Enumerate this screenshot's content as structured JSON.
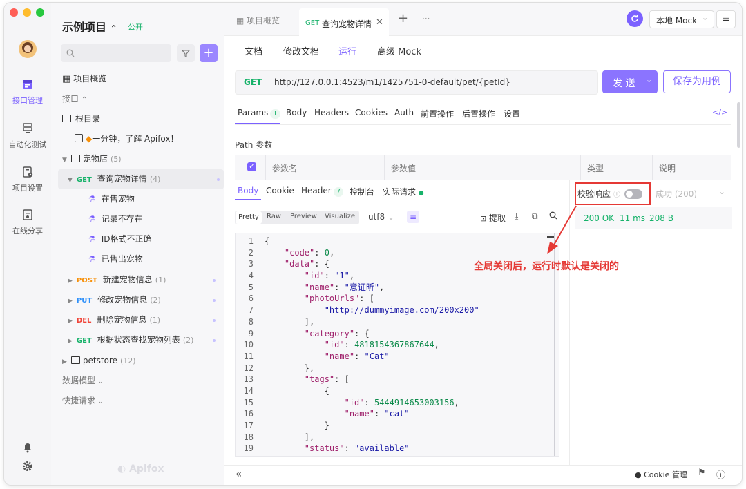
{
  "window": {
    "traffic_lights": [
      "#ff5f57",
      "#febc2e",
      "#28c840"
    ]
  },
  "rail": {
    "items": [
      {
        "label": "接口管理",
        "icon": "api-management-icon",
        "active": true
      },
      {
        "label": "自动化测试",
        "icon": "automation-test-icon",
        "active": false
      },
      {
        "label": "项目设置",
        "icon": "project-settings-icon",
        "active": false
      },
      {
        "label": "在线分享",
        "icon": "online-share-icon",
        "active": false
      }
    ],
    "bottom_icons": [
      "bell-icon",
      "gear-icon"
    ]
  },
  "sidebar": {
    "project_name": "示例项目",
    "project_visibility": "公开",
    "overview_label": "项目概览",
    "interfaces_label": "接口",
    "root_label": "根目录",
    "intro_doc": "一分钟，了解 Apifox！",
    "petstore_folder": {
      "label": "宠物店",
      "count": "(5)"
    },
    "active_endpoint": {
      "method": "GET",
      "label": "查询宠物详情",
      "count": "(4)"
    },
    "cases": [
      "在售宠物",
      "记录不存在",
      "ID格式不正确",
      "已售出宠物"
    ],
    "endpoints": [
      {
        "method": "POST",
        "label": "新建宠物信息",
        "count": "(1)"
      },
      {
        "method": "PUT",
        "label": "修改宠物信息",
        "count": "(2)"
      },
      {
        "method": "DEL",
        "label": "删除宠物信息",
        "count": "(1)"
      },
      {
        "method": "GET",
        "label": "根据状态查找宠物列表",
        "count": "(2)"
      }
    ],
    "petstore2": {
      "label": "petstore",
      "count": "(12)"
    },
    "data_models": "数据模型",
    "quick_request": "快捷请求",
    "watermark": "Apifox"
  },
  "tabs": {
    "overview": "项目概览",
    "active": {
      "method": "GET",
      "label": "查询宠物详情"
    },
    "add": "+",
    "more": "···",
    "env": "本地 Mock"
  },
  "subtabs": [
    "文档",
    "修改文档",
    "运行",
    "高级 Mock"
  ],
  "request": {
    "method": "GET",
    "url": "http://127.0.0.1:4523/m1/1425751-0-default/pet/{petId}",
    "send": "发 送",
    "save": "保存为用例"
  },
  "param_tabs": [
    {
      "label": "Params",
      "badge": "1"
    },
    {
      "label": "Body"
    },
    {
      "label": "Headers"
    },
    {
      "label": "Cookies"
    },
    {
      "label": "Auth"
    },
    {
      "label": "前置操作"
    },
    {
      "label": "后置操作"
    },
    {
      "label": "设置"
    }
  ],
  "path_params": {
    "title": "Path 参数",
    "columns": [
      "参数名",
      "参数值",
      "类型",
      "说明"
    ]
  },
  "response": {
    "tabs": [
      {
        "label": "Body"
      },
      {
        "label": "Cookie"
      },
      {
        "label": "Header",
        "badge": "7"
      },
      {
        "label": "控制台"
      },
      {
        "label": "实际请求"
      }
    ],
    "formats": [
      "Pretty",
      "Raw",
      "Preview",
      "Visualize"
    ],
    "encoding": "utf8",
    "extract": "提取",
    "validate_label": "校验响应",
    "validate_value": "成功 (200)",
    "status": "200 OK",
    "time": "11 ms",
    "size": "208 B",
    "annotation": "全局关闭后，运行时默认是关闭的",
    "code_lines": [
      [
        "{"
      ],
      [
        "    ",
        [
          "k",
          "\"code\""
        ],
        ": ",
        [
          "n",
          "0"
        ],
        ","
      ],
      [
        "    ",
        [
          "k",
          "\"data\""
        ],
        ": {"
      ],
      [
        "        ",
        [
          "k",
          "\"id\""
        ],
        ": ",
        [
          "s",
          "\"1\""
        ],
        ","
      ],
      [
        "        ",
        [
          "k",
          "\"name\""
        ],
        ": ",
        [
          "s",
          "\"意证昕\""
        ],
        ","
      ],
      [
        "        ",
        [
          "k",
          "\"photoUrls\""
        ],
        ": ["
      ],
      [
        "            ",
        [
          "u",
          "\"http://dummyimage.com/200x200\""
        ]
      ],
      [
        "        ],"
      ],
      [
        "        ",
        [
          "k",
          "\"category\""
        ],
        ": {"
      ],
      [
        "            ",
        [
          "k",
          "\"id\""
        ],
        ": ",
        [
          "n",
          "4818154367867644"
        ],
        ","
      ],
      [
        "            ",
        [
          "k",
          "\"name\""
        ],
        ": ",
        [
          "s",
          "\"Cat\""
        ]
      ],
      [
        "        },"
      ],
      [
        "        ",
        [
          "k",
          "\"tags\""
        ],
        ": ["
      ],
      [
        "            {"
      ],
      [
        "                ",
        [
          "k",
          "\"id\""
        ],
        ": ",
        [
          "n",
          "5444914653003156"
        ],
        ","
      ],
      [
        "                ",
        [
          "k",
          "\"name\""
        ],
        ": ",
        [
          "s",
          "\"cat\""
        ]
      ],
      [
        "            }"
      ],
      [
        "        ],"
      ],
      [
        "        ",
        [
          "k",
          "\"status\""
        ],
        ": ",
        [
          "s",
          "\"available\""
        ]
      ]
    ]
  },
  "footer": {
    "cookie": "Cookie 管理",
    "collapse": "«"
  },
  "colors": {
    "accent": "#7b61ff",
    "annotation": "#e53935",
    "success": "#17b26a"
  }
}
